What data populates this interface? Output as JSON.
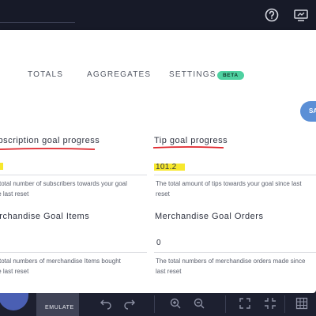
{
  "tabs": [
    {
      "label": "TOTALS"
    },
    {
      "label": "AGGREGATES"
    },
    {
      "label": "SETTINGS"
    }
  ],
  "beta_badge": "BETA",
  "save_button": "SA",
  "fields": {
    "subscription": {
      "title": "Subscription goal progress",
      "value": "",
      "desc_line1": "The total number of subscribers towards your goal",
      "desc_line2": "since last reset"
    },
    "tip": {
      "title": "Tip goal progress",
      "value": "101.2",
      "desc_line1": "The total amount of tips towards your goal since last",
      "desc_line2": "reset"
    },
    "merch_items": {
      "title": "Merchandise Goal Items",
      "value": "",
      "desc_line1": "The total numbers of merchandise Items bought",
      "desc_line2": "since last reset"
    },
    "merch_orders": {
      "title": "Merchandise Goal Orders",
      "value": "0",
      "desc_line1": "The total numbers of merchandise orders made since",
      "desc_line2": "last reset"
    }
  },
  "toolbar": {
    "emulate_label": "EMULATE"
  },
  "icons": {
    "help": "help-circle-icon",
    "screen": "screen-share-icon",
    "undo": "undo-icon",
    "redo": "redo-icon",
    "zoom_in": "zoom-in-icon",
    "zoom_out": "zoom-out-icon",
    "fullscreen": "fullscreen-icon",
    "exit_fullscreen": "exit-fullscreen-icon",
    "grid": "grid-icon"
  },
  "colors": {
    "beta": "#4fd1a1",
    "save": "#5b8fd6",
    "highlight": "#f7e82d",
    "annotation": "#e0242a"
  }
}
